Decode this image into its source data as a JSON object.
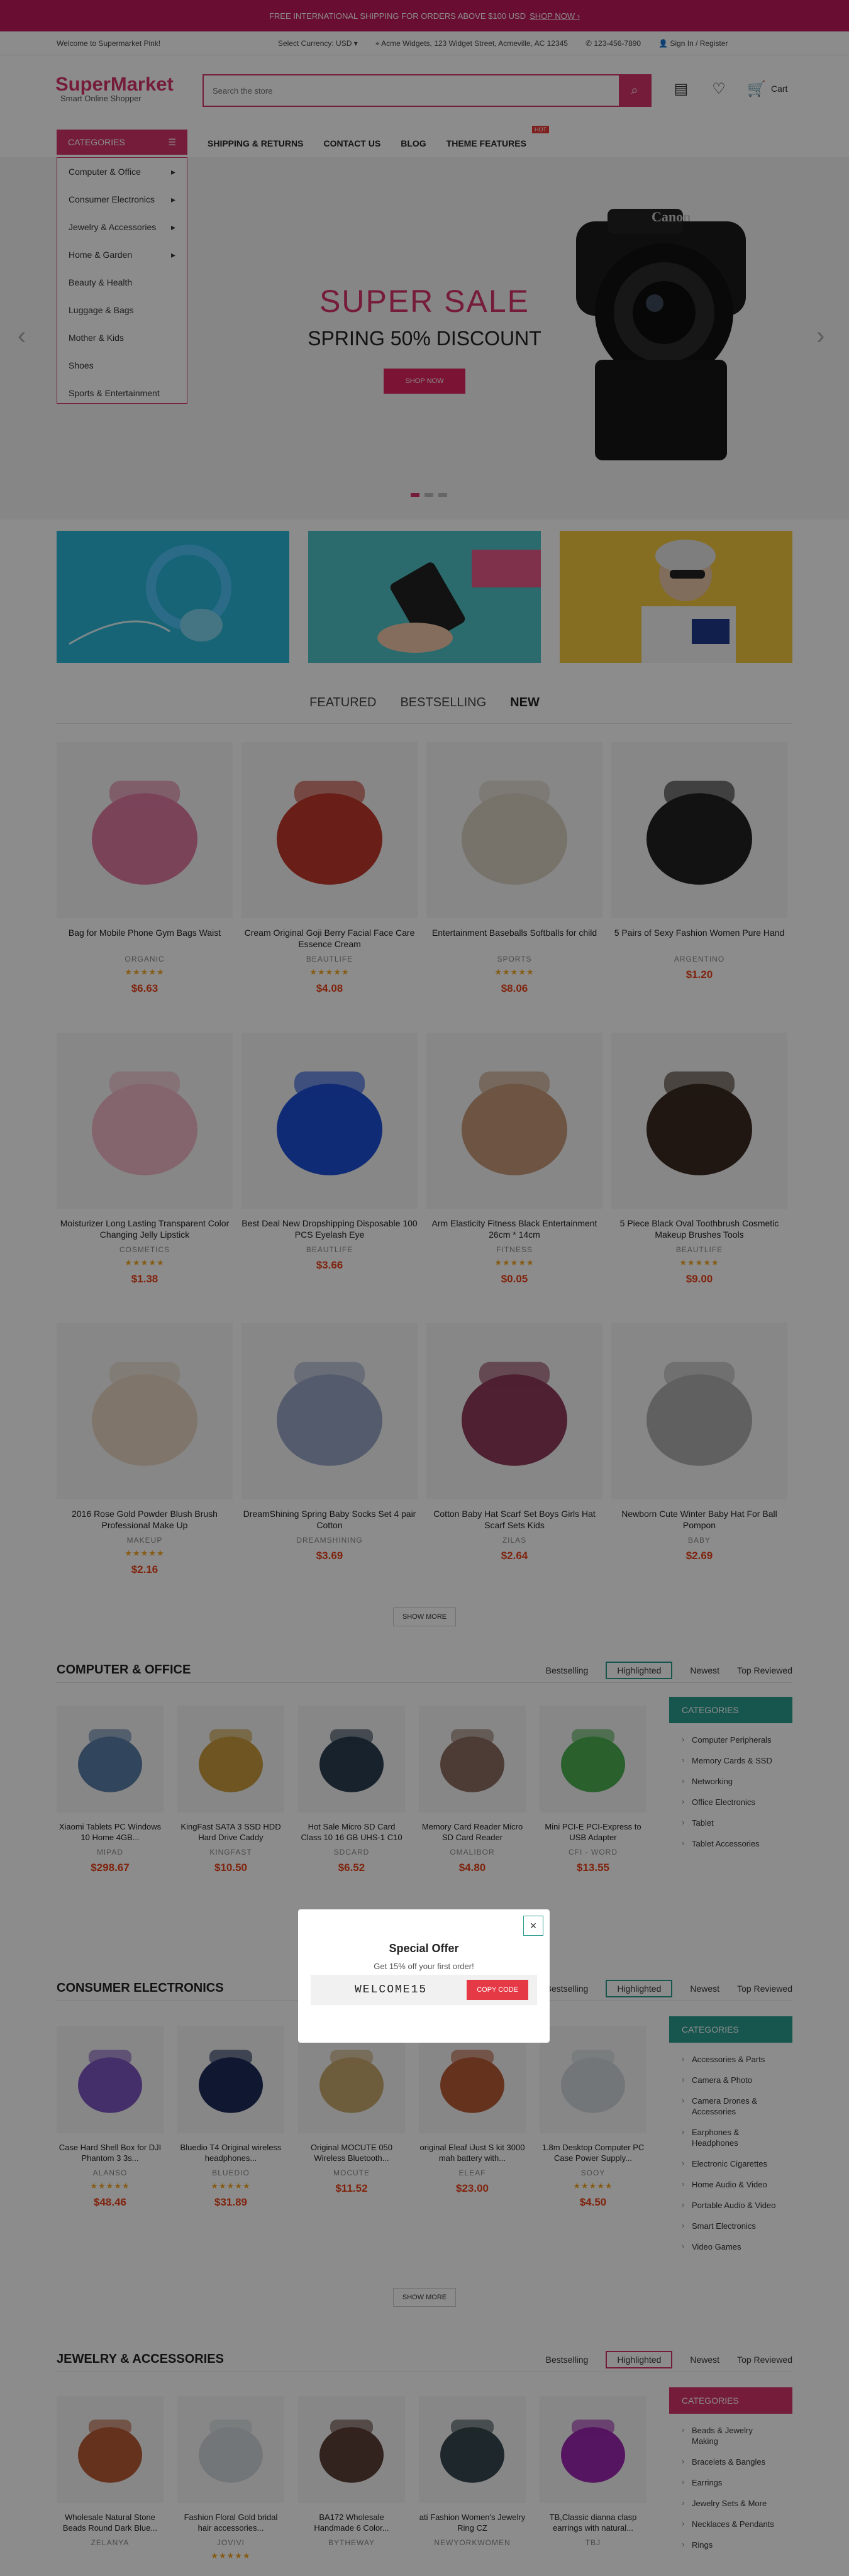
{
  "topbar": {
    "text": "FREE INTERNATIONAL SHIPPING FOR ORDERS ABOVE $100 USD",
    "link": "SHOP NOW ›"
  },
  "infobar": {
    "welcome": "Welcome to Supermarket Pink!",
    "currency": "Select Currency: USD ▾",
    "address": "Acme Widgets, 123 Widget Street, Acmeville, AC 12345",
    "phone": "123-456-7890",
    "account": "Sign In / Register"
  },
  "logo": {
    "name": "SuperMarket",
    "tagline": "Smart Online Shopper"
  },
  "search": {
    "placeholder": "Search the store"
  },
  "header": {
    "cart_label": "Cart"
  },
  "nav": {
    "categories_label": "CATEGORIES",
    "links": [
      "SHIPPING & RETURNS",
      "CONTACT US",
      "BLOG",
      "THEME FEATURES"
    ],
    "hot": "HOT"
  },
  "category_menu": [
    "Computer & Office",
    "Consumer Electronics",
    "Jewelry & Accessories",
    "Home & Garden",
    "Beauty & Health",
    "Luggage & Bags",
    "Mother & Kids",
    "Shoes",
    "Sports & Entertainment"
  ],
  "slider": {
    "title": "SUPER SALE",
    "subtitle": "SPRING 50% DISCOUNT",
    "button": "SHOP NOW",
    "brand": "Canon"
  },
  "tabs": [
    "FEATURED",
    "BESTSELLING",
    "NEW"
  ],
  "products": [
    {
      "name": "Bag for Mobile Phone Gym Bags Waist",
      "brand": "ORGANIC",
      "stars": "★★★★★",
      "price": "$6.63"
    },
    {
      "name": "Cream Original Goji Berry Facial Face Care Essence Cream",
      "brand": "BEAUTLIFE",
      "stars": "★★★★★",
      "price": "$4.08"
    },
    {
      "name": "Entertainment Baseballs Softballs for child",
      "brand": "SPORTS",
      "stars": "★★★★★",
      "price": "$8.06"
    },
    {
      "name": "5 Pairs of Sexy Fashion Women Pure Hand",
      "brand": "ARGENTINO",
      "stars": "",
      "price": "$1.20"
    },
    {
      "name": "Moisturizer Long Lasting Transparent Color Changing Jelly Lipstick",
      "brand": "COSMETICS",
      "stars": "★★★★★",
      "price": "$1.38"
    },
    {
      "name": "Best Deal New Dropshipping Disposable 100 PCS Eyelash Eye",
      "brand": "BEAUTLIFE",
      "stars": "",
      "price": "$3.66"
    },
    {
      "name": "Arm Elasticity Fitness Black Entertainment 26cm * 14cm",
      "brand": "FITNESS",
      "stars": "★★★★★",
      "price": "$0.05"
    },
    {
      "name": "5 Piece Black Oval Toothbrush Cosmetic Makeup Brushes Tools",
      "brand": "BEAUTLIFE",
      "stars": "★★★★★",
      "price": "$9.00"
    },
    {
      "name": "2016 Rose Gold Powder Blush Brush Professional Make Up",
      "brand": "MAKEUP",
      "stars": "★★★★★",
      "price": "$2.16"
    },
    {
      "name": "DreamShining Spring Baby Socks Set 4 pair Cotton",
      "brand": "DREAMSHINING",
      "stars": "",
      "price": "$3.69"
    },
    {
      "name": "Cotton Baby Hat Scarf Set Boys Girls Hat Scarf Sets Kids",
      "brand": "ZILAS",
      "stars": "",
      "price": "$2.64"
    },
    {
      "name": "Newborn Cute Winter Baby Hat For Ball Pompon",
      "brand": "BABY",
      "stars": "",
      "price": "$2.69"
    }
  ],
  "show_more": "SHOW MORE",
  "section_tabs": [
    "Bestselling",
    "Highlighted",
    "Newest",
    "Top Reviewed"
  ],
  "computer": {
    "title": "COMPUTER & OFFICE",
    "products": [
      {
        "name": "Xiaomi Tablets PC Windows 10 Home 4GB...",
        "brand": "MIPAD",
        "stars": "",
        "price": "$298.67"
      },
      {
        "name": "KingFast SATA 3 SSD HDD Hard Drive Caddy",
        "brand": "KINGFAST",
        "stars": "",
        "price": "$10.50"
      },
      {
        "name": "Hot Sale Micro SD Card Class 10 16 GB UHS-1 C10",
        "brand": "SDCARD",
        "stars": "",
        "price": "$6.52"
      },
      {
        "name": "Memory Card Reader Micro SD Card Reader",
        "brand": "OMALIBOR",
        "stars": "",
        "price": "$4.80"
      },
      {
        "name": "Mini PCI-E PCI-Express to USB Adapter",
        "brand": "CFI - WORD",
        "stars": "",
        "price": "$13.55"
      }
    ],
    "sidebar": {
      "title": "CATEGORIES",
      "items": [
        "Computer Peripherals",
        "Memory Cards & SSD",
        "Networking",
        "Office Electronics",
        "Tablet",
        "Tablet Accessories"
      ]
    }
  },
  "electronics": {
    "title": "CONSUMER ELECTRONICS",
    "products": [
      {
        "name": "Case Hard Shell Box for DJI Phantom 3 3s...",
        "brand": "ALANSO",
        "stars": "★★★★★",
        "price": "$48.46"
      },
      {
        "name": "Bluedio T4 Original wireless headphones...",
        "brand": "BLUEDIO",
        "stars": "★★★★★",
        "price": "$31.89"
      },
      {
        "name": "Original MOCUTE 050 Wireless Bluetooth...",
        "brand": "MOCUTE",
        "stars": "",
        "price": "$11.52"
      },
      {
        "name": "original Eleaf iJust S kit 3000 mah battery with...",
        "brand": "ELEAF",
        "stars": "",
        "price": "$23.00"
      },
      {
        "name": "1.8m Desktop Computer PC Case Power Supply...",
        "brand": "SOOY",
        "stars": "★★★★★",
        "price": "$4.50"
      }
    ],
    "sidebar": {
      "title": "CATEGORIES",
      "items": [
        "Accessories & Parts",
        "Camera & Photo",
        "Camera Drones & Accessories",
        "Earphones & Headphones",
        "Electronic Cigarettes",
        "Home Audio & Video",
        "Portable Audio & Video",
        "Smart Electronics",
        "Video Games"
      ]
    }
  },
  "jewelry": {
    "title": "JEWELRY & ACCESSORIES",
    "products": [
      {
        "name": "Wholesale Natural Stone Beads Round Dark Blue...",
        "brand": "ZELANYA",
        "stars": "",
        "price": ""
      },
      {
        "name": "Fashion Floral Gold bridal hair accessories...",
        "brand": "JOVIVI",
        "stars": "★★★★★",
        "price": ""
      },
      {
        "name": "BA172 Wholesale Handmade 6 Color...",
        "brand": "BYTHEWAY",
        "stars": "",
        "price": ""
      },
      {
        "name": "ati Fashion Women's Jewelry Ring CZ",
        "brand": "NEWYORKWOMEN",
        "stars": "",
        "price": ""
      },
      {
        "name": "TB,Classic dianna clasp earrings with natural...",
        "brand": "TBJ",
        "stars": "",
        "price": ""
      }
    ],
    "sidebar": {
      "title": "CATEGORIES",
      "items": [
        "Beads & Jewelry Making",
        "Bracelets & Bangles",
        "Earrings",
        "Jewelry Sets & More",
        "Necklaces & Pendants",
        "Rings"
      ]
    }
  },
  "modal": {
    "title": "Special Offer",
    "subtitle": "Get 15% off your first order!",
    "code": "WELCOME15",
    "copy": "COPY CODE",
    "close": "×"
  }
}
